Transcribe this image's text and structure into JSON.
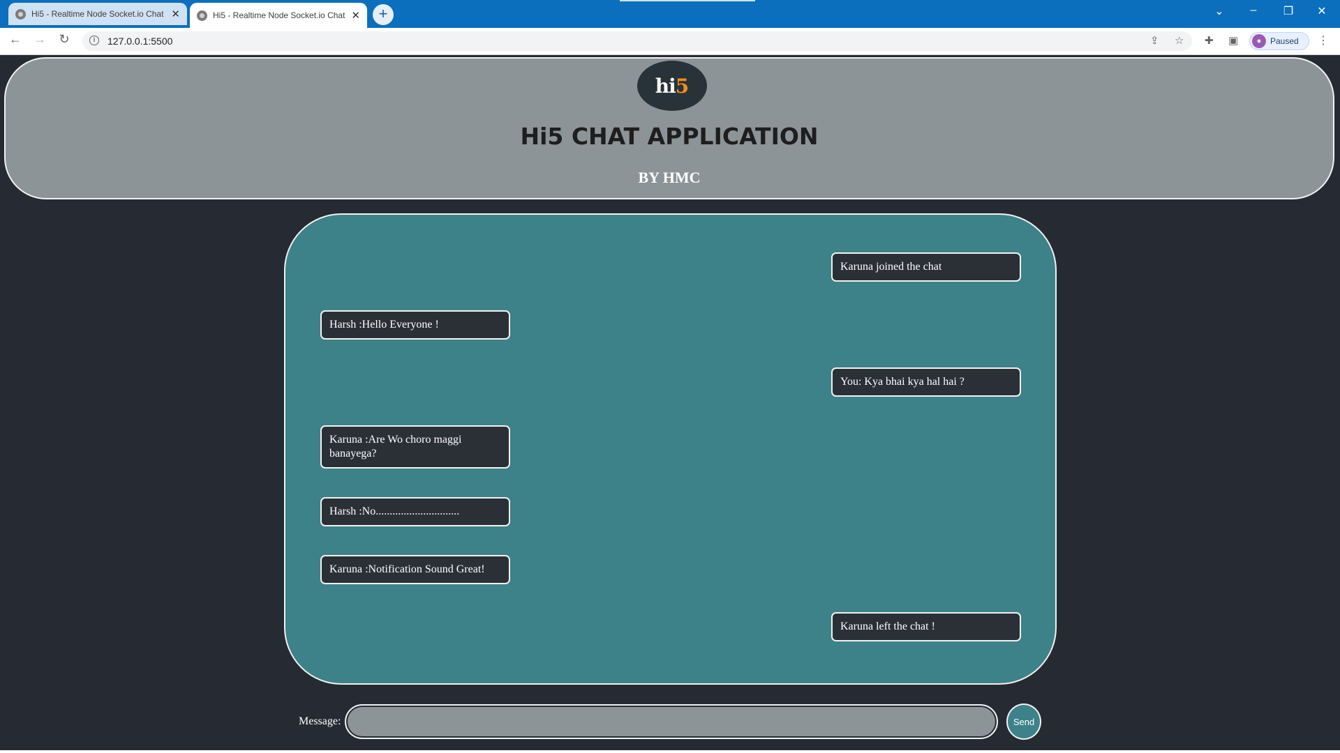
{
  "browser": {
    "tabs": [
      {
        "title": "Hi5 - Realtime Node Socket.io Chat",
        "active": false
      },
      {
        "title": "Hi5 - Realtime Node Socket.io Chat",
        "active": true
      }
    ],
    "new_tab_label": "+",
    "url": "127.0.0.1:5500",
    "profile_label": "Paused"
  },
  "header": {
    "logo_hi": "hi",
    "logo_five": "5",
    "title": "Hi5 CHAT APPLICATION",
    "byline": "BY HMC"
  },
  "chat": {
    "messages": [
      {
        "text": "Karuna joined the chat",
        "side": "right"
      },
      {
        "text": "Harsh :Hello Everyone !",
        "side": "left"
      },
      {
        "text": "You: Kya bhai kya hal hai ?",
        "side": "right"
      },
      {
        "text": "Karuna :Are Wo choro maggi banayega?",
        "side": "left"
      },
      {
        "text": "Harsh :No..............................",
        "side": "left"
      },
      {
        "text": "Karuna :Notification Sound Great!",
        "side": "left"
      },
      {
        "text": "Karuna left the chat !",
        "side": "right"
      }
    ]
  },
  "composer": {
    "label": "Message:",
    "input_value": "",
    "send_label": "Send"
  },
  "colors": {
    "page_background": "#262a33",
    "header_background": "#8d9497",
    "chat_background": "#3d8288",
    "bubble_background": "#2b2f36",
    "logo_accent": "#f28c1c",
    "browser_tabbar": "#0b6fbd"
  }
}
